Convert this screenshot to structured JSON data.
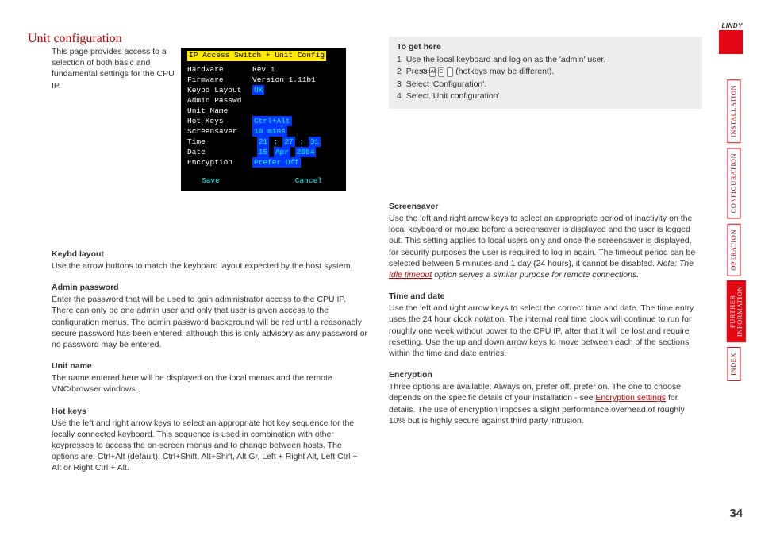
{
  "page": {
    "title": "Unit configuration",
    "intro": "This page provides access to a selection of both basic and fundamental settings for the CPU IP.",
    "number": "34"
  },
  "terminal": {
    "title": "IP Access Switch + Unit Config",
    "rows": {
      "hardware_label": "Hardware",
      "hardware_value": "Rev 1",
      "firmware_label": "Firmware",
      "firmware_value": "Version 1.11b1",
      "keybd_label": "Keybd Layout",
      "keybd_value": "UK",
      "admin_label": "Admin Passwd",
      "admin_value": "",
      "unitname_label": "Unit Name",
      "unitname_value": "",
      "hotkeys_label": "Hot Keys",
      "hotkeys_value": "Ctrl+Alt",
      "screensaver_label": "Screensaver",
      "screensaver_value": "10 mins",
      "time_label": "Time",
      "time_h": "21",
      "time_m": "27",
      "time_s": "31",
      "date_label": "Date",
      "date_d": "15",
      "date_m": "Apr",
      "date_y": "2004",
      "encryption_label": "Encryption",
      "encryption_value": "Prefer Off"
    },
    "save": "Save",
    "cancel": "Cancel"
  },
  "to_get_here": {
    "heading": "To get here",
    "s1": "Use the local keyboard and log on as the 'admin' user.",
    "s2a": "Press ",
    "k1": "Ctrl",
    "k2": "Alt",
    "k3": "C",
    "s2b": " (hotkeys may be different).",
    "s3": "Select 'Configuration'.",
    "s4": "Select 'Unit configuration'."
  },
  "left": {
    "h1": "Keybd layout",
    "p1": "Use the arrow buttons to match the keyboard layout expected by the host system.",
    "h2": "Admin password",
    "p2": "Enter the password that will be used to gain administrator access to the CPU IP. There can only be one admin user and only that user is given access to the configuration menus. The admin password background will be red until a reasonably secure password has been entered, although this is only advisory as any password or no password may be entered.",
    "h3": "Unit name",
    "p3": "The name entered here will be displayed on the local menus and the remote VNC/browser windows.",
    "h4": "Hot keys",
    "p4": "Use the left and right arrow keys to select an appropriate hot key sequence for the locally connected keyboard. This sequence is used in combination with other keypresses to access the on-screen menus and to change between hosts. The options are: Ctrl+Alt (default), Ctrl+Shift, Alt+Shift, Alt Gr, Left + Right Alt, Left Ctrl + Alt or Right Ctrl + Alt."
  },
  "right": {
    "h1": "Screensaver",
    "p1a": "Use the left and right arrow keys to select an appropriate period of inactivity on the local keyboard or mouse before a screensaver is displayed and the user is logged out. This setting applies to local users only and once the screensaver is displayed, for security purposes the user is required to log in again. The timeout period can be selected between 5 minutes and 1 day (24 hours), it cannot be disabled. ",
    "p1note_prefix": "Note: The ",
    "p1link": "Idle timeout",
    "p1note_suffix": " option serves a similar purpose for remote connections.",
    "h2": "Time and date",
    "p2": "Use the left and right arrow keys to select the correct time and date. The time entry uses the 24 hour clock notation. The internal real time clock will continue to run for roughly one week without power to the CPU IP, after that it will be lost and require resetting. Use the up and down arrow keys to move between each of the sections within the time and date entries.",
    "h3": "Encryption",
    "p3a": "Three options are available: Always on, prefer off, prefer on. The one to choose depends on the specific details of your installation - see ",
    "p3link": "Encryption settings",
    "p3b": " for details. The use of encryption imposes a slight performance overhead of roughly 10% but is highly secure against third party intrusion."
  },
  "rail": {
    "logo_text": "LINDY",
    "t1": "installation",
    "t2": "configuration",
    "t3": "operation",
    "t4a": "further",
    "t4b": "information",
    "t5": "index"
  }
}
